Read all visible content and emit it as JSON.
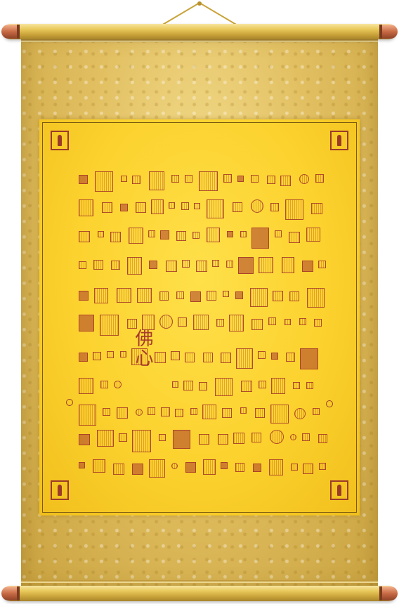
{
  "scroll": {
    "colors": {
      "panel": "#fcd22e",
      "brocade": "#e2c062",
      "rod": "#e8c85a",
      "rod_cap": "#c86a44",
      "seal_ink": "#a63b2b"
    },
    "calligraphy_text": "佛心"
  }
}
